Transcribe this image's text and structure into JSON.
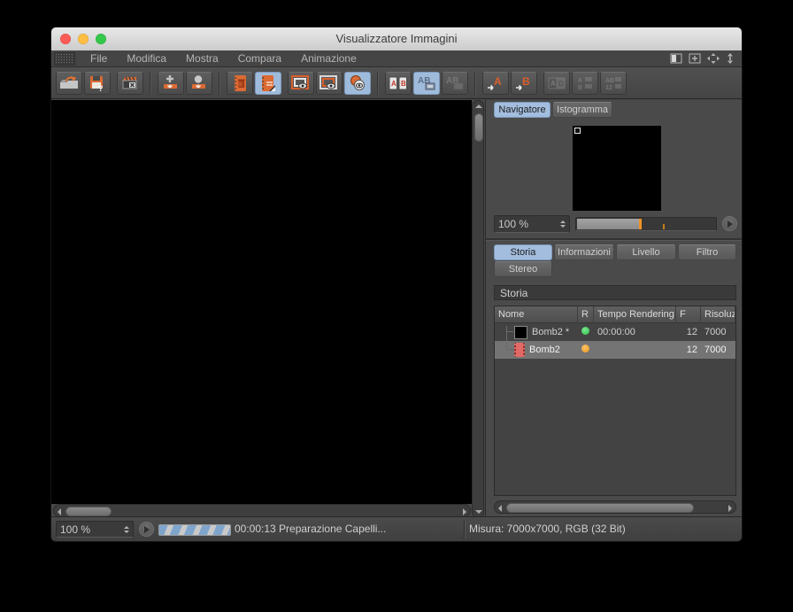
{
  "colors": {
    "accent_orange": "#db6a33",
    "active_blue": "#9fbbdc",
    "status_green": "#2fbf4e",
    "status_amber": "#e9941c",
    "traffic_red": "#fc5b57",
    "traffic_yellow": "#fdbe41",
    "traffic_green": "#34c84a",
    "selected_row": "#747474"
  },
  "window": {
    "title": "Visualizzatore Immagini"
  },
  "menu": {
    "items": [
      "File",
      "Modifica",
      "Mostra",
      "Compara",
      "Animazione"
    ]
  },
  "toolbar": {
    "icons": [
      "open-image",
      "save-image",
      "clear-render",
      "fit-image",
      "region-render",
      "remove-from-history",
      "toggle-history (active)",
      "set-compare-a",
      "set-compare-b",
      "compare-ab (active)",
      "ab-side-by-side",
      "ab-onscreen (active)",
      "ab-onscreen-disabled",
      "goto-image-a",
      "goto-image-b",
      "swap-ab-disabled",
      "align-ab-disabled",
      "ab-frames-disabled"
    ],
    "glyphs": {
      "a": "A",
      "b": "B",
      "d": "D",
      "ab": "AB",
      "q": "?",
      "n12": "12"
    }
  },
  "navigator": {
    "tab_navigator": "Navigatore",
    "tab_histogram": "Istogramma",
    "zoom_value": "100 %"
  },
  "history": {
    "tab_storia": "Storia",
    "tab_informazioni": "Informazioni",
    "tab_livello": "Livello",
    "tab_filtro": "Filtro",
    "tab_stereo": "Stereo",
    "section_title": "Storia",
    "columns": {
      "name": "Nome",
      "r": "R",
      "time": "Tempo Rendering",
      "f": "F",
      "resolution": "Risoluz"
    },
    "rows": [
      {
        "name": "Bomb2 *",
        "status": "green",
        "time": "00:00:00",
        "frames": "12",
        "resolution": "7000"
      },
      {
        "name": "Bomb2",
        "status": "amber",
        "time": "",
        "frames": "12",
        "resolution": "7000"
      }
    ]
  },
  "status": {
    "zoom_value": "100 %",
    "progress_text": "00:00:13 Preparazione Capelli...",
    "info": "Misura: 7000x7000, RGB (32 Bit)"
  }
}
